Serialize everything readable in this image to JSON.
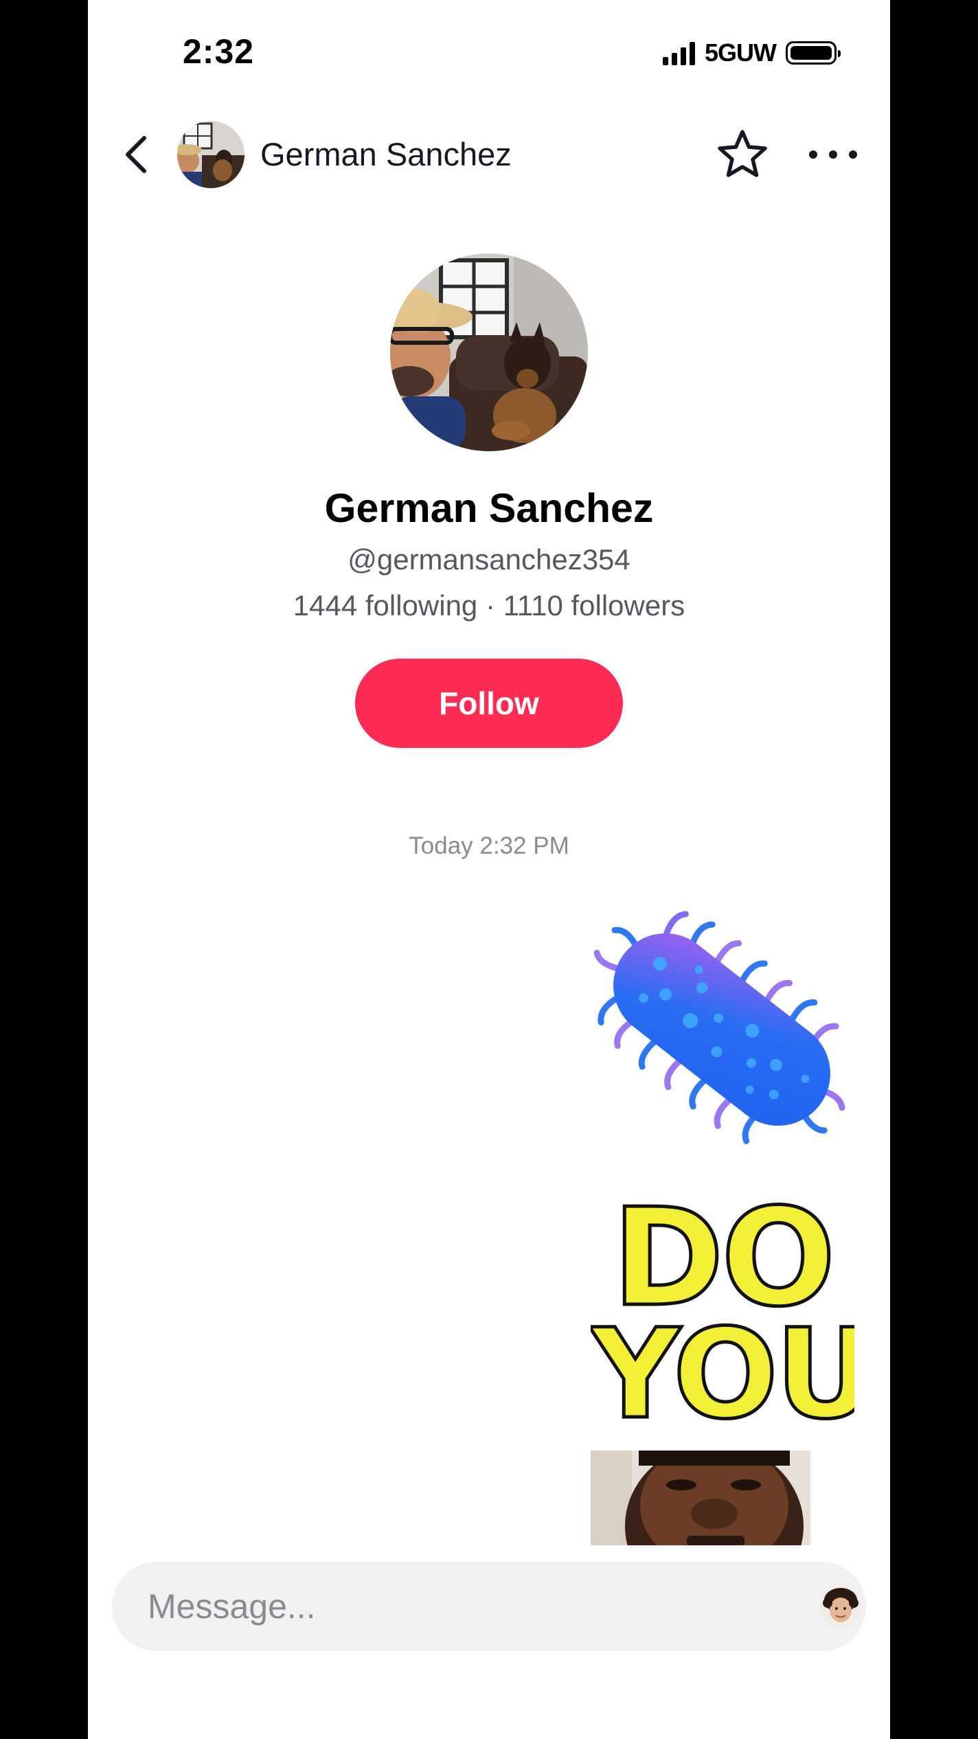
{
  "status_bar": {
    "time": "2:32",
    "network": "5GUW",
    "icons": [
      "signal-icon",
      "battery-icon"
    ]
  },
  "header": {
    "back_icon": "chevron-left-icon",
    "name": "German Sanchez",
    "favorite_icon": "star-outline-icon",
    "more_icon": "more-horizontal-icon"
  },
  "profile": {
    "name": "German Sanchez",
    "handle": "@germansanchez354",
    "stats": "1444 following · 1110 followers",
    "follow_label": "Follow"
  },
  "chat": {
    "timestamp": "Today 2:32 PM",
    "messages": [
      {
        "type": "sticker",
        "name": "microbe-sticker"
      },
      {
        "type": "gif",
        "text_line_1": "DO",
        "text_line_2": "YOU"
      }
    ]
  },
  "composer": {
    "placeholder": "Message..."
  },
  "colors": {
    "accent": "#fe2c55",
    "text_primary": "#161823",
    "text_secondary": "#57575f",
    "timestamp": "#8a8b91",
    "input_bg": "#f1f1f2"
  }
}
